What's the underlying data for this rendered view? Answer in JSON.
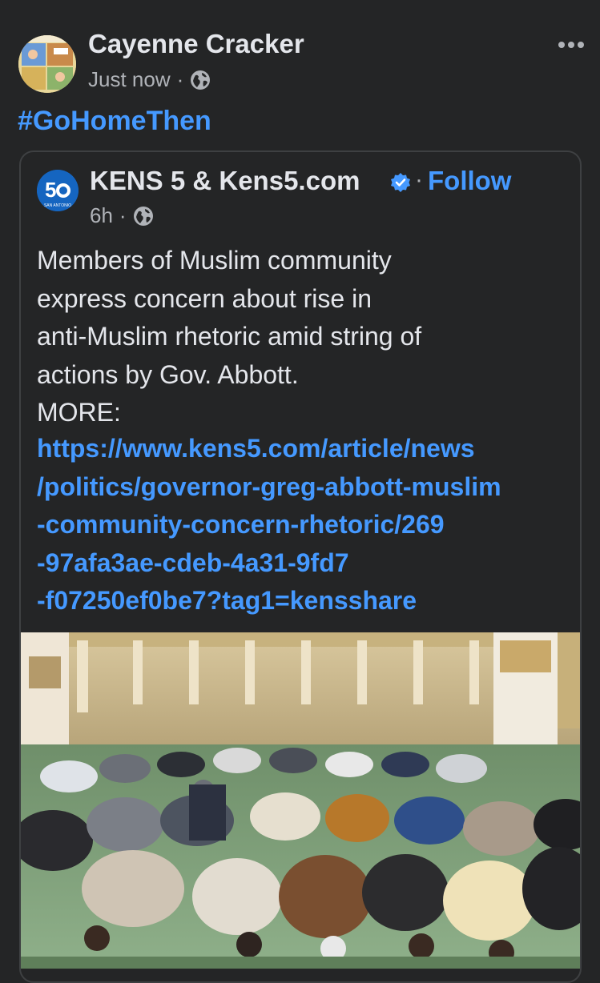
{
  "post": {
    "author": "Cayenne Cracker",
    "timestamp": "Just now",
    "separator": "·",
    "privacy_icon": "globe-icon",
    "more_icon": "ellipsis-icon",
    "hashtag": "#GoHomeThen"
  },
  "shared": {
    "page_name": "KENS 5 & Kens5.com",
    "verified_icon": "verified-badge-icon",
    "separator": "·",
    "follow_label": "Follow",
    "timestamp": "6h",
    "logo_text": "5",
    "logo_subtext": "SAN ANTONIO",
    "body": "Members of Muslim community\nexpress concern about rise in\nanti-Muslim rhetoric amid string of\nactions by Gov. Abbott.\nMORE:",
    "link": "https://www.kens5.com/article/news\n/politics/governor-greg-abbott-muslim\n-community-concern-rhetoric/269\n-97afa3ae-cdeb-4a31-9fd7\n-f07250ef0be7?tag1=kensshare"
  },
  "colors": {
    "background": "#242526",
    "text_primary": "#e4e6eb",
    "text_secondary": "#b0b3b8",
    "link": "#4599ff",
    "card_border": "#3e4042"
  }
}
